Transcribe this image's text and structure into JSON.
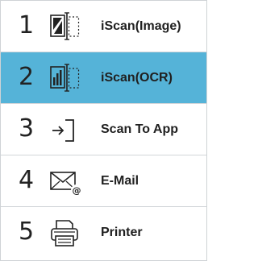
{
  "menu": {
    "selected_index": 1,
    "items": [
      {
        "number": "1",
        "label": "iScan(Image)",
        "icon": "scan-image-icon"
      },
      {
        "number": "2",
        "label": "iScan(OCR)",
        "icon": "scan-ocr-icon"
      },
      {
        "number": "3",
        "label": "Scan To App",
        "icon": "scan-to-app-icon"
      },
      {
        "number": "4",
        "label": "E-Mail",
        "icon": "email-icon"
      },
      {
        "number": "5",
        "label": "Printer",
        "icon": "printer-icon"
      }
    ]
  },
  "colors": {
    "selected_background": "#55b3d8",
    "text": "#202020",
    "divider": "#d2d6d9"
  }
}
